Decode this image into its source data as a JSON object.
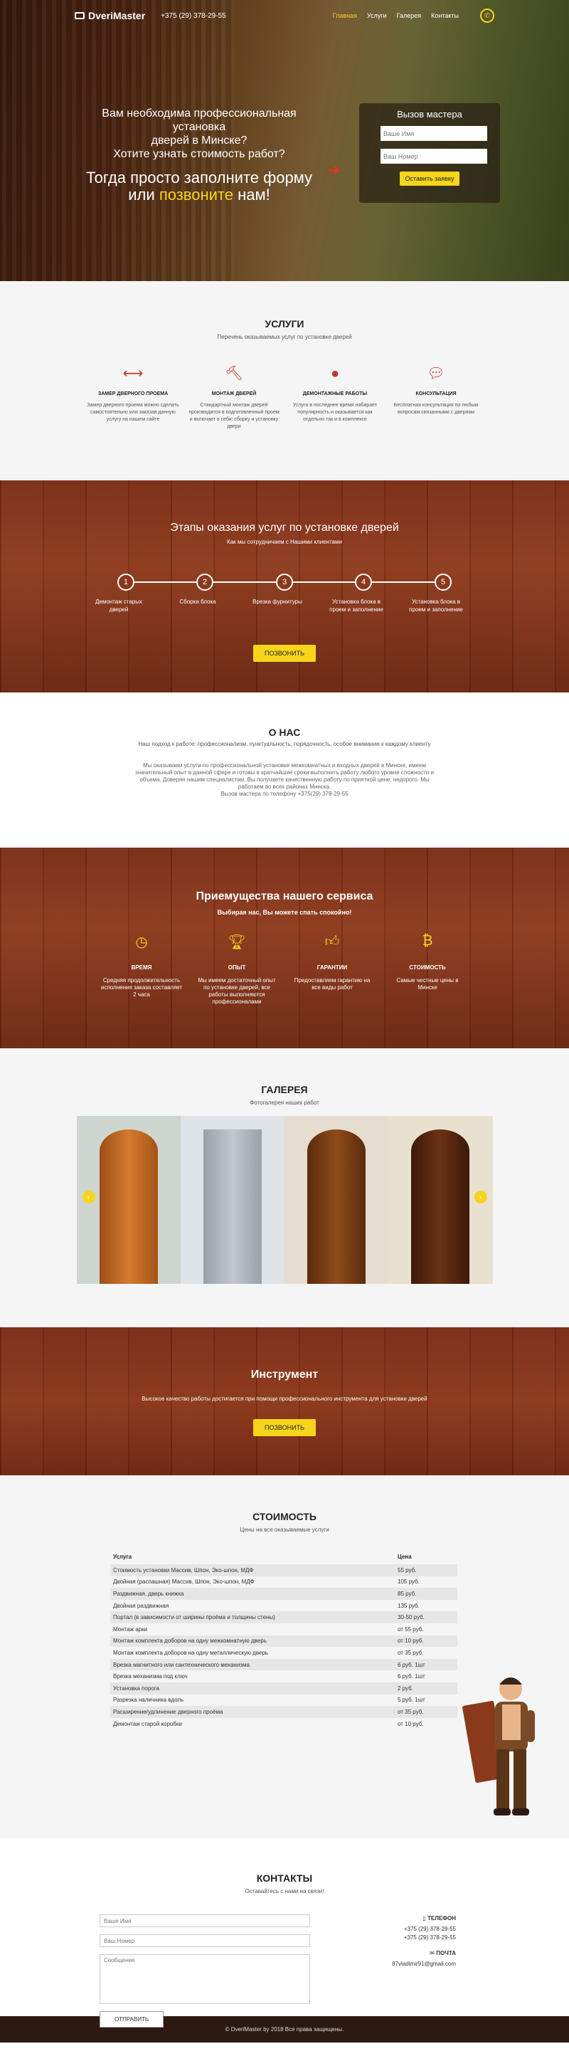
{
  "header": {
    "logo": "DveriMaster",
    "phone": "+375 (29) 378-29-55",
    "menu": [
      "Главная",
      "Услуги",
      "Галерея",
      "Контакты"
    ]
  },
  "hero": {
    "line1": "Вам необходима профессиональная установка",
    "line2": "дверей в Минске?",
    "line3": "Хотите узнать стоимость работ?",
    "line4": "Тогда просто заполните форму",
    "line5a": "или",
    "line5b": "позвоните",
    "line5c": "нам!"
  },
  "callback": {
    "title": "Вызов мастера",
    "name_placeholder": "Ваше Имя",
    "phone_placeholder": "Ваш Номер",
    "submit": "Оставить заявку"
  },
  "services": {
    "title": "УСЛУГИ",
    "subtitle": "Перечень оказываемых услуг по установке дверей",
    "items": [
      {
        "title": "ЗАМЕР ДВЕРНОГО ПРОЕМА",
        "desc": "Замер дверного проема можно сделать самостоятельно или заказав данную услугу на нашем сайте"
      },
      {
        "title": "МОНТАЖ ДВЕРЕЙ",
        "desc": "Стандартный монтаж дверей производится в подготовленный проем и включает в себя: сборку и установку двери"
      },
      {
        "title": "ДЕМОНТАЖНЫЕ РАБОТЫ",
        "desc": "Услуга в последнее время набирает популярность и оказывается как отдельно так и в комплексе"
      },
      {
        "title": "КОНСУЛЬТАЦИЯ",
        "desc": "Бесплатная консультация по любым вопросам связанными с дверями"
      }
    ]
  },
  "stages": {
    "title": "Этапы оказания услуг по установке дверей",
    "subtitle": "Как мы сотрудничаем с Нашими клиентами",
    "steps": [
      {
        "num": "1",
        "label": "Демонтаж старых дверей"
      },
      {
        "num": "2",
        "label": "Сборка блока"
      },
      {
        "num": "3",
        "label": "Врезка фурнитуры"
      },
      {
        "num": "4",
        "label": "Установка блока в проем и заполнение"
      },
      {
        "num": "5",
        "label": "Установка блока в проем и заполнение"
      }
    ],
    "button": "ПОЗВОНИТЬ"
  },
  "about": {
    "title": "О НАС",
    "subtitle": "Наш подход к работе: профессионализм, пунктуальность, порядочность, особое внимание к каждому клиенту",
    "text": "Мы оказываем услуги по профессиональной установке межкомнатных и входных дверей в Минске, имеем значительный опыт в данной сфере и готовы в кратчайшие сроки выполнить работу любого уровня сложности и объема. Доверяя нашим специалистам, Вы получаете качественную работу по приятной цене, недорого. Мы работаем во всех районах Минска.",
    "phone_line": "Вызов мастера по телефону +375(29) 378-29-55"
  },
  "advantages": {
    "title": "Приемущества нашего сервиса",
    "tagline": "Выбирая нас, Вы можете спать спокойно!",
    "items": [
      {
        "title": "ВРЕМЯ",
        "desc": "Средняя продолжительность исполнения заказа составляет 2 часа"
      },
      {
        "title": "ОПЫТ",
        "desc": "Мы имеем достаточный опыт по установке дверей, все работы выполняются профессионалами"
      },
      {
        "title": "ГАРАНТИИ",
        "desc": "Предоставляем гарантию на все виды работ"
      },
      {
        "title": "СТОИМОСТЬ",
        "desc": "Самые честные цены в Минске"
      }
    ]
  },
  "gallery": {
    "title": "ГАЛЕРЕЯ",
    "subtitle": "Фотогалерея наших работ"
  },
  "tools": {
    "title": "Инструмент",
    "subtitle": "Высокое качество работы достигается при помощи профессионального инструмента для установки дверей",
    "button": "ПОЗВОНИТЬ"
  },
  "prices": {
    "title": "СТОИМОСТЬ",
    "subtitle": "Цены на все оказываемые услуги",
    "col_service": "Услуга",
    "col_price": "Цена",
    "rows": [
      [
        "Стоимость установки Массив, Шпон, Эко-шпон, МДФ",
        "55 руб."
      ],
      [
        "Двойная (распашная) Массив, Шпон, Эко-шпон, МДФ",
        "105 руб."
      ],
      [
        "Раздвижная, дверь книжка",
        "85 руб."
      ],
      [
        "Двойная раздвижная",
        "135 руб."
      ],
      [
        "Портал (в зависимости от ширины проёма и толщины стены)",
        "30-50 руб."
      ],
      [
        "Монтаж арки",
        "от 55 руб."
      ],
      [
        "Монтаж комплекта доборов на одну межкомнатную дверь",
        "от 10 руб."
      ],
      [
        "Монтаж комплекта доборов на одну металлическую дверь",
        "от 35 руб."
      ],
      [
        "Врезка магнитного или сантехнического механизма",
        "6 руб. 1шт"
      ],
      [
        "Врезка механизма под ключ",
        "6 руб. 1шт"
      ],
      [
        "Установка порога",
        "2 руб."
      ],
      [
        "Разрезка наличника вдоль",
        "5 руб. 1шт"
      ],
      [
        "Расширение/удлинение дверного проёма",
        "от 35 руб."
      ],
      [
        "Демонтаж старой коробки",
        "от 10 руб."
      ]
    ]
  },
  "contacts": {
    "title": "КОНТАКТЫ",
    "subtitle": "Оставайтесь с нами на связи!",
    "name_placeholder": "Ваше Имя",
    "phone_placeholder": "Ваш Номер",
    "message_placeholder": "Сообщение",
    "submit": "ОТПРАВИТЬ",
    "phone_heading": "ТЕЛЕФОН",
    "phone1": "+375 (29) 378-29-55",
    "phone2": "+375 (29) 378-29-55",
    "mail_heading": "ПОЧТА",
    "email": "87vladimir91@gmail.com"
  },
  "footer": {
    "text": "© DveriMaster by 2018 Все права защищены."
  },
  "colors": {
    "accent": "#f6d51c",
    "icon_red": "#c0392b",
    "wood": "#8f3a1c"
  }
}
